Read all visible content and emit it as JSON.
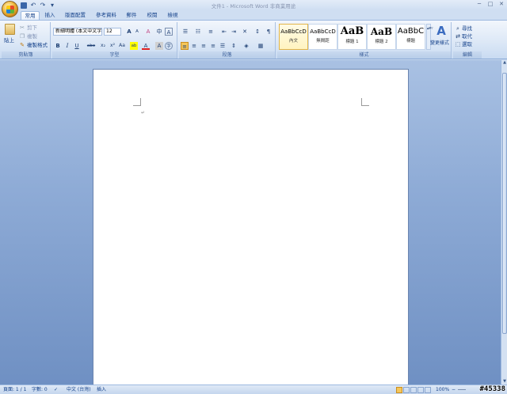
{
  "window": {
    "title": "文件1 - Microsoft Word 非商業用途",
    "minimize": "─",
    "restore": "□",
    "close": "✕"
  },
  "qat": {
    "undo": "↶",
    "redo": "↷",
    "more": "▾"
  },
  "tabs": [
    "常用",
    "插入",
    "版面配置",
    "參考資料",
    "郵件",
    "校閱",
    "檢視"
  ],
  "clipboard": {
    "paste_label": "貼上",
    "cut_label": "剪下",
    "copy_label": "複製",
    "format_painter_label": "複製格式",
    "group_label": "剪貼簿"
  },
  "font": {
    "font_name": "新細明體 (本文中文字)",
    "font_size": "12",
    "grow": "A",
    "shrink": "A",
    "clear": "A",
    "phonetic": "中",
    "bold": "B",
    "italic": "I",
    "underline": "U",
    "strike": "abe",
    "subscript": "x₂",
    "superscript": "x²",
    "change_case": "Aa",
    "highlight": "ab",
    "font_color": "A",
    "char_border": "A",
    "enclose": "字",
    "group_label": "字型"
  },
  "paragraph": {
    "group_label": "段落"
  },
  "styles": {
    "items": [
      {
        "sample": "AaBbCcD",
        "name": "內文"
      },
      {
        "sample": "AaBbCcD",
        "name": "無間距"
      },
      {
        "sample": "AaB",
        "name": "標題 1"
      },
      {
        "sample": "AaB",
        "name": "標題 2"
      },
      {
        "sample": "AaBbC",
        "name": "標題"
      }
    ],
    "change_styles_label": "變更樣式",
    "group_label": "樣式"
  },
  "editing": {
    "find_label": "尋找",
    "replace_label": "取代",
    "select_label": "選取",
    "group_label": "編輯"
  },
  "document": {
    "paragraph_mark": "↵"
  },
  "status": {
    "page": "頁面: 1 / 1",
    "words": "字數: 0",
    "language": "中文 (台灣)",
    "mode": "插入",
    "zoom": "100%",
    "zoom_minus": "−",
    "zoom_plus": "+"
  },
  "watermark": "#45338",
  "colors": {
    "accent": "#15428b",
    "ribbon_top": "#f2f6fc",
    "workspace": "#8eabd6",
    "highlight": "#ffff00",
    "font_red": "#e02020"
  }
}
